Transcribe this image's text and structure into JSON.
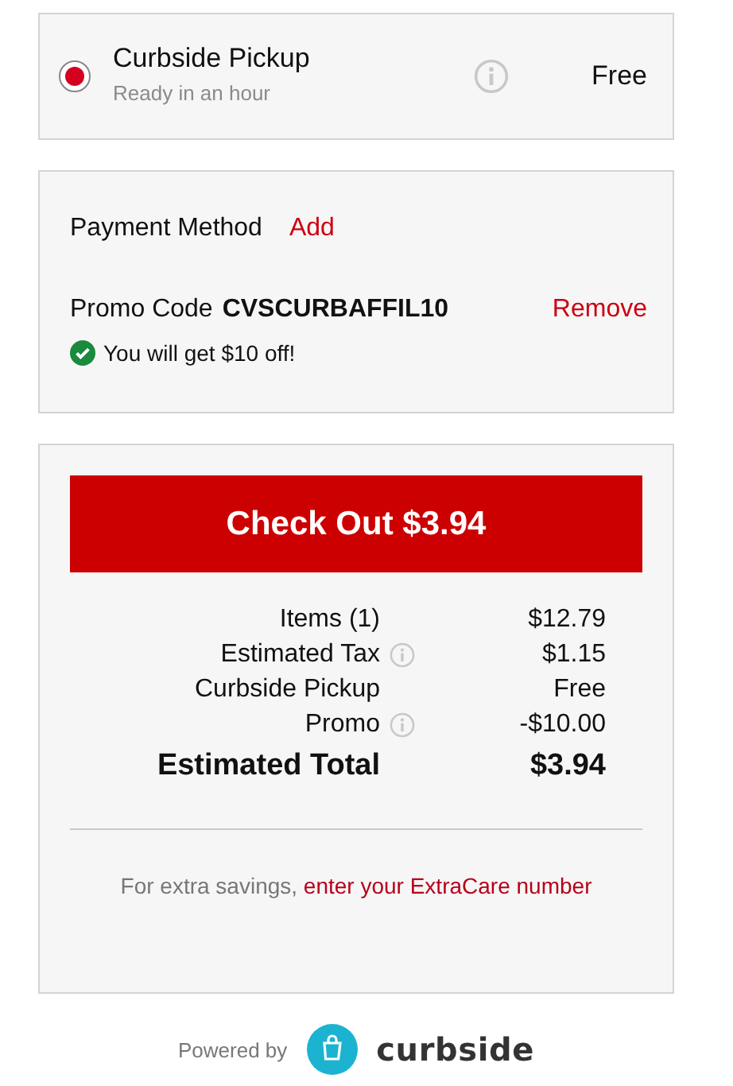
{
  "delivery_option": {
    "title": "Curbside Pickup",
    "subtitle": "Ready in an hour",
    "price": "Free",
    "selected": true
  },
  "payment": {
    "label": "Payment Method",
    "action": "Add"
  },
  "promo": {
    "label": "Promo Code",
    "code": "CVSCURBAFFIL10",
    "action": "Remove",
    "message": "You will get $10 off!"
  },
  "checkout_button": "Check Out $3.94",
  "summary": [
    {
      "label": "Items (1)",
      "value": "$12.79",
      "info": false,
      "kind": "line"
    },
    {
      "label": "Estimated Tax",
      "value": "$1.15",
      "info": true,
      "kind": "line"
    },
    {
      "label": "Curbside Pickup",
      "value": "Free",
      "info": false,
      "kind": "line"
    },
    {
      "label": "Promo",
      "value": "-$10.00",
      "info": true,
      "kind": "line"
    },
    {
      "label": "Estimated Total",
      "value": "$3.94",
      "info": false,
      "kind": "total"
    }
  ],
  "extracare": {
    "text": "For extra savings,",
    "link": "enter your ExtraCare number"
  },
  "footer": {
    "powered_by": "Powered by",
    "brand": "curbside"
  }
}
